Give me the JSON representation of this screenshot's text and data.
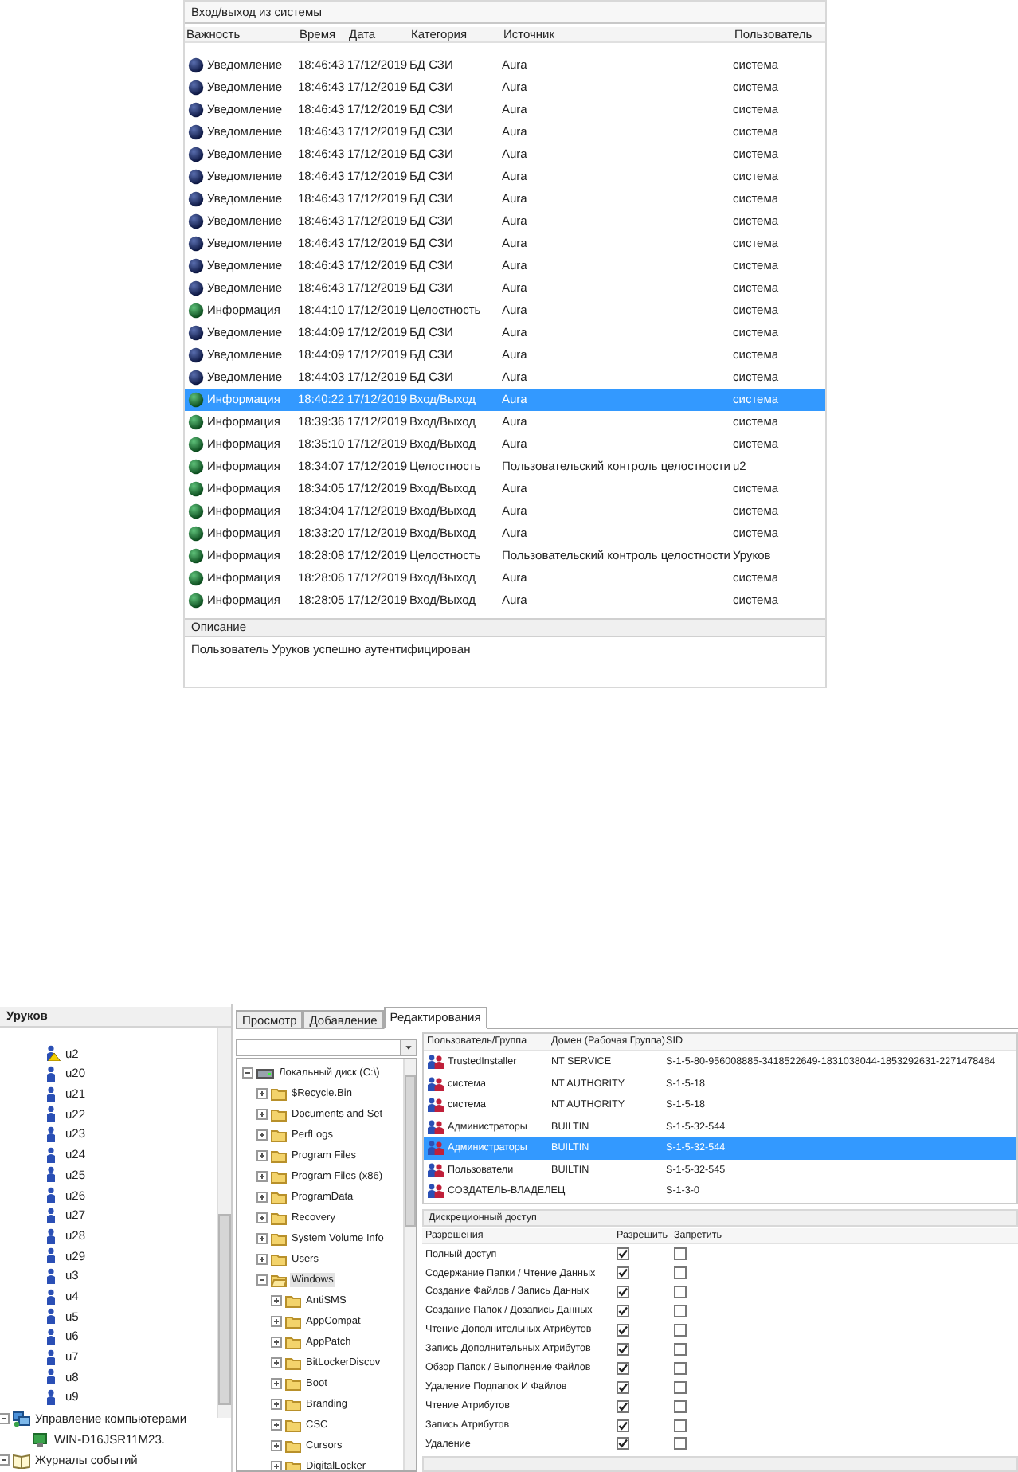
{
  "event_log": {
    "title": "Вход/выход из системы",
    "columns": [
      "Важность",
      "Время",
      "Дата",
      "Категория",
      "Источник",
      "Пользователь"
    ],
    "rows": [
      {
        "kind": "notice",
        "severity": "Уведомление",
        "time": "18:46:43",
        "date": "17/12/2019",
        "category": "БД СЗИ",
        "source": "Aura",
        "user": "система",
        "selected": false
      },
      {
        "kind": "notice",
        "severity": "Уведомление",
        "time": "18:46:43",
        "date": "17/12/2019",
        "category": "БД СЗИ",
        "source": "Aura",
        "user": "система",
        "selected": false
      },
      {
        "kind": "notice",
        "severity": "Уведомление",
        "time": "18:46:43",
        "date": "17/12/2019",
        "category": "БД СЗИ",
        "source": "Aura",
        "user": "система",
        "selected": false
      },
      {
        "kind": "notice",
        "severity": "Уведомление",
        "time": "18:46:43",
        "date": "17/12/2019",
        "category": "БД СЗИ",
        "source": "Aura",
        "user": "система",
        "selected": false
      },
      {
        "kind": "notice",
        "severity": "Уведомление",
        "time": "18:46:43",
        "date": "17/12/2019",
        "category": "БД СЗИ",
        "source": "Aura",
        "user": "система",
        "selected": false
      },
      {
        "kind": "notice",
        "severity": "Уведомление",
        "time": "18:46:43",
        "date": "17/12/2019",
        "category": "БД СЗИ",
        "source": "Aura",
        "user": "система",
        "selected": false
      },
      {
        "kind": "notice",
        "severity": "Уведомление",
        "time": "18:46:43",
        "date": "17/12/2019",
        "category": "БД СЗИ",
        "source": "Aura",
        "user": "система",
        "selected": false
      },
      {
        "kind": "notice",
        "severity": "Уведомление",
        "time": "18:46:43",
        "date": "17/12/2019",
        "category": "БД СЗИ",
        "source": "Aura",
        "user": "система",
        "selected": false
      },
      {
        "kind": "notice",
        "severity": "Уведомление",
        "time": "18:46:43",
        "date": "17/12/2019",
        "category": "БД СЗИ",
        "source": "Aura",
        "user": "система",
        "selected": false
      },
      {
        "kind": "notice",
        "severity": "Уведомление",
        "time": "18:46:43",
        "date": "17/12/2019",
        "category": "БД СЗИ",
        "source": "Aura",
        "user": "система",
        "selected": false
      },
      {
        "kind": "notice",
        "severity": "Уведомление",
        "time": "18:46:43",
        "date": "17/12/2019",
        "category": "БД СЗИ",
        "source": "Aura",
        "user": "система",
        "selected": false
      },
      {
        "kind": "info",
        "severity": "Информация",
        "time": "18:44:10",
        "date": "17/12/2019",
        "category": "Целостность",
        "source": "Aura",
        "user": "система",
        "selected": false
      },
      {
        "kind": "notice",
        "severity": "Уведомление",
        "time": "18:44:09",
        "date": "17/12/2019",
        "category": "БД СЗИ",
        "source": "Aura",
        "user": "система",
        "selected": false
      },
      {
        "kind": "notice",
        "severity": "Уведомление",
        "time": "18:44:09",
        "date": "17/12/2019",
        "category": "БД СЗИ",
        "source": "Aura",
        "user": "система",
        "selected": false
      },
      {
        "kind": "notice",
        "severity": "Уведомление",
        "time": "18:44:03",
        "date": "17/12/2019",
        "category": "БД СЗИ",
        "source": "Aura",
        "user": "система",
        "selected": false
      },
      {
        "kind": "info",
        "severity": "Информация",
        "time": "18:40:22",
        "date": "17/12/2019",
        "category": "Вход/Выход",
        "source": "Aura",
        "user": "система",
        "selected": true
      },
      {
        "kind": "info",
        "severity": "Информация",
        "time": "18:39:36",
        "date": "17/12/2019",
        "category": "Вход/Выход",
        "source": "Aura",
        "user": "система",
        "selected": false
      },
      {
        "kind": "info",
        "severity": "Информация",
        "time": "18:35:10",
        "date": "17/12/2019",
        "category": "Вход/Выход",
        "source": "Aura",
        "user": "система",
        "selected": false
      },
      {
        "kind": "info",
        "severity": "Информация",
        "time": "18:34:07",
        "date": "17/12/2019",
        "category": "Целостность",
        "source": "Пользовательский контроль целостности",
        "user": "u2",
        "selected": false
      },
      {
        "kind": "info",
        "severity": "Информация",
        "time": "18:34:05",
        "date": "17/12/2019",
        "category": "Вход/Выход",
        "source": "Aura",
        "user": "система",
        "selected": false
      },
      {
        "kind": "info",
        "severity": "Информация",
        "time": "18:34:04",
        "date": "17/12/2019",
        "category": "Вход/Выход",
        "source": "Aura",
        "user": "система",
        "selected": false
      },
      {
        "kind": "info",
        "severity": "Информация",
        "time": "18:33:20",
        "date": "17/12/2019",
        "category": "Вход/Выход",
        "source": "Aura",
        "user": "система",
        "selected": false
      },
      {
        "kind": "info",
        "severity": "Информация",
        "time": "18:28:08",
        "date": "17/12/2019",
        "category": "Целостность",
        "source": "Пользовательский контроль целостности",
        "user": "Уруков",
        "selected": false
      },
      {
        "kind": "info",
        "severity": "Информация",
        "time": "18:28:06",
        "date": "17/12/2019",
        "category": "Вход/Выход",
        "source": "Aura",
        "user": "система",
        "selected": false
      },
      {
        "kind": "info",
        "severity": "Информация",
        "time": "18:28:05",
        "date": "17/12/2019",
        "category": "Вход/Выход",
        "source": "Aura",
        "user": "система",
        "selected": false
      }
    ],
    "description": {
      "heading": "Описание",
      "text": "Пользователь Уруков успешно аутентифицирован"
    }
  },
  "security_window": {
    "left_panel": {
      "title": "Уруков",
      "users": [
        {
          "label": "u2",
          "warning": true
        },
        {
          "label": "u20",
          "warning": false
        },
        {
          "label": "u21",
          "warning": false
        },
        {
          "label": "u22",
          "warning": false
        },
        {
          "label": "u23",
          "warning": false
        },
        {
          "label": "u24",
          "warning": false
        },
        {
          "label": "u25",
          "warning": false
        },
        {
          "label": "u26",
          "warning": false
        },
        {
          "label": "u27",
          "warning": false
        },
        {
          "label": "u28",
          "warning": false
        },
        {
          "label": "u29",
          "warning": false
        },
        {
          "label": "u3",
          "warning": false
        },
        {
          "label": "u4",
          "warning": false
        },
        {
          "label": "u5",
          "warning": false
        },
        {
          "label": "u6",
          "warning": false
        },
        {
          "label": "u7",
          "warning": false
        },
        {
          "label": "u8",
          "warning": false
        },
        {
          "label": "u9",
          "warning": false
        }
      ],
      "tree": [
        {
          "label": "Управление компьютерами",
          "kind": "computers",
          "expanded": true,
          "children": [
            {
              "label": "WIN-D16JSR11M23.",
              "kind": "computer"
            }
          ]
        },
        {
          "label": "Журналы событий",
          "kind": "logs",
          "expanded": true
        }
      ]
    },
    "tabs": [
      {
        "label": "Просмотр",
        "selected": false
      },
      {
        "label": "Добавление",
        "selected": false
      },
      {
        "label": "Редактирования",
        "selected": true
      }
    ],
    "folder_tree": [
      {
        "label": "Локальный диск (C:\\)",
        "kind": "drive",
        "expanded": true,
        "selected": false,
        "children": [
          {
            "label": "$Recycle.Bin",
            "kind": "folder",
            "expanded": false,
            "selected": false
          },
          {
            "label": "Documents and Set",
            "kind": "folder",
            "expanded": false,
            "selected": false
          },
          {
            "label": "PerfLogs",
            "kind": "folder",
            "expanded": false,
            "selected": false
          },
          {
            "label": "Program Files",
            "kind": "folder",
            "expanded": false,
            "selected": false
          },
          {
            "label": "Program Files (x86)",
            "kind": "folder",
            "expanded": false,
            "selected": false
          },
          {
            "label": "ProgramData",
            "kind": "folder",
            "expanded": false,
            "selected": false
          },
          {
            "label": "Recovery",
            "kind": "folder",
            "expanded": false,
            "selected": false
          },
          {
            "label": "System Volume Info",
            "kind": "folder",
            "expanded": false,
            "selected": false
          },
          {
            "label": "Users",
            "kind": "folder",
            "expanded": false,
            "selected": false
          },
          {
            "label": "Windows",
            "kind": "folder",
            "expanded": true,
            "selected": true,
            "children": [
              {
                "label": "AntiSMS",
                "kind": "folder",
                "expanded": false,
                "selected": false
              },
              {
                "label": "AppCompat",
                "kind": "folder",
                "expanded": false,
                "selected": false
              },
              {
                "label": "AppPatch",
                "kind": "folder",
                "expanded": false,
                "selected": false
              },
              {
                "label": "BitLockerDiscov",
                "kind": "folder",
                "expanded": false,
                "selected": false
              },
              {
                "label": "Boot",
                "kind": "folder",
                "expanded": false,
                "selected": false
              },
              {
                "label": "Branding",
                "kind": "folder",
                "expanded": false,
                "selected": false
              },
              {
                "label": "CSC",
                "kind": "folder",
                "expanded": false,
                "selected": false
              },
              {
                "label": "Cursors",
                "kind": "folder",
                "expanded": false,
                "selected": false
              },
              {
                "label": "DigitalLocker",
                "kind": "folder",
                "expanded": false,
                "selected": false
              }
            ]
          }
        ]
      }
    ],
    "accounts": {
      "columns": [
        "Пользователь/Группа",
        "Домен (Рабочая Группа)",
        "SID"
      ],
      "rows": [
        {
          "name": "TrustedInstaller",
          "domain": "NT SERVICE",
          "sid": "S-1-5-80-956008885-3418522649-1831038044-1853292631-2271478464",
          "selected": false
        },
        {
          "name": "система",
          "domain": "NT AUTHORITY",
          "sid": "S-1-5-18",
          "selected": false
        },
        {
          "name": "система",
          "domain": "NT AUTHORITY",
          "sid": "S-1-5-18",
          "selected": false
        },
        {
          "name": "Администраторы",
          "domain": "BUILTIN",
          "sid": "S-1-5-32-544",
          "selected": false
        },
        {
          "name": "Администраторы",
          "domain": "BUILTIN",
          "sid": "S-1-5-32-544",
          "selected": true
        },
        {
          "name": "Пользователи",
          "domain": "BUILTIN",
          "sid": "S-1-5-32-545",
          "selected": false
        },
        {
          "name": "СОЗДАТЕЛЬ-ВЛАДЕЛЕЦ",
          "sid": "S-1-3-0",
          "selected": false
        }
      ]
    },
    "dacl": {
      "title": "Дискреционный доступ",
      "columns": [
        "Разрешения",
        "Разрешить",
        "Запретить"
      ],
      "rows": [
        {
          "label": "Полный доступ",
          "allow": true,
          "deny": false
        },
        {
          "label": "Содержание Папки / Чтение Данных",
          "allow": true,
          "deny": false
        },
        {
          "label": "Создание Файлов / Запись Данных",
          "allow": true,
          "deny": false
        },
        {
          "label": "Создание Папок / Дозапись Данных",
          "allow": true,
          "deny": false
        },
        {
          "label": "Чтение Дополнительных Атрибутов",
          "allow": true,
          "deny": false
        },
        {
          "label": "Запись Дополнительных Атрибутов",
          "allow": true,
          "deny": false
        },
        {
          "label": "Обзор Папок / Выполнение Файлов",
          "allow": true,
          "deny": false
        },
        {
          "label": "Удаление Подпапок И Файлов",
          "allow": true,
          "deny": false
        },
        {
          "label": "Чтение Атрибутов",
          "allow": true,
          "deny": false
        },
        {
          "label": "Запись Атрибутов",
          "allow": true,
          "deny": false
        },
        {
          "label": "Удаление",
          "allow": true,
          "deny": false
        }
      ]
    }
  }
}
